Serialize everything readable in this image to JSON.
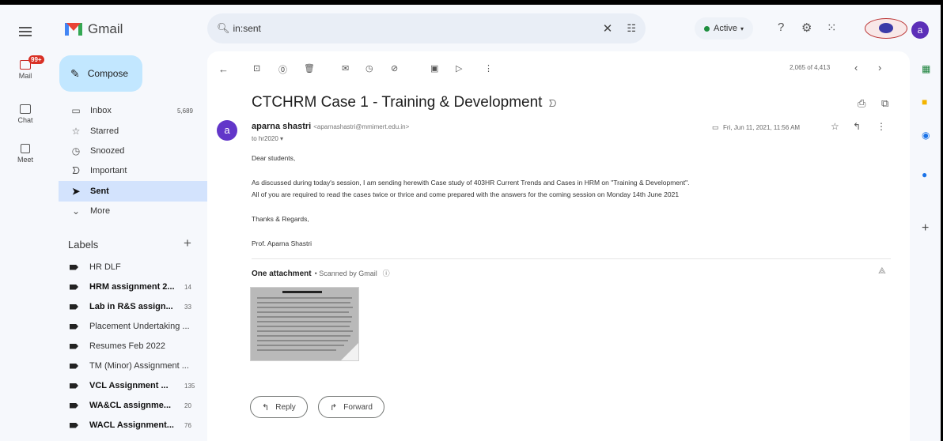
{
  "app": {
    "name": "Gmail"
  },
  "search": {
    "value": "in:sent"
  },
  "status": {
    "active_label": "Active"
  },
  "account": {
    "initial": "a"
  },
  "rail": {
    "mail_badge": "99+",
    "mail": "Mail",
    "chat": "Chat",
    "meet": "Meet"
  },
  "sidebar": {
    "compose": "Compose",
    "nav": [
      {
        "label": "Inbox",
        "count": "5,689",
        "icon": "inbox-icon"
      },
      {
        "label": "Starred",
        "count": "",
        "icon": "star-icon"
      },
      {
        "label": "Snoozed",
        "count": "",
        "icon": "clock-icon"
      },
      {
        "label": "Important",
        "count": "",
        "icon": "important-icon"
      },
      {
        "label": "Sent",
        "count": "",
        "icon": "send-icon"
      },
      {
        "label": "More",
        "count": "",
        "icon": "chevron-down-icon"
      }
    ],
    "labels_title": "Labels",
    "labels": [
      {
        "name": "HR DLF",
        "count": "",
        "bold": false
      },
      {
        "name": "HRM assignment 2...",
        "count": "14",
        "bold": true
      },
      {
        "name": "Lab in R&S assign...",
        "count": "33",
        "bold": true
      },
      {
        "name": "Placement Undertaking ...",
        "count": "",
        "bold": false
      },
      {
        "name": "Resumes Feb 2022",
        "count": "",
        "bold": false
      },
      {
        "name": "TM (Minor) Assignment ...",
        "count": "",
        "bold": false
      },
      {
        "name": "VCL Assignment ...",
        "count": "135",
        "bold": true
      },
      {
        "name": "WA&CL assignme...",
        "count": "20",
        "bold": true
      },
      {
        "name": "WACL Assignment...",
        "count": "76",
        "bold": true
      }
    ]
  },
  "toolbar": {
    "pager": "2,065 of 4,413"
  },
  "email": {
    "subject": "CTCHRM Case 1 - Training & Development",
    "sender_initial": "a",
    "sender_name": "aparna shastri",
    "sender_email": "<aparnashastri@mmimert.edu.in>",
    "to": "to hr2020",
    "date": "Fri, Jun 11, 2021, 11:56 AM",
    "body": [
      "Dear students,",
      "As discussed during today's session, I am sending herewith Case study of 403HR Current Trends and Cases in HRM on \"Training & Development\".",
      " All of you are required to read the cases twice or thrice and come prepared with the answers for the coming session on Monday 14th June 2021",
      "Thanks & Regards,",
      "Prof. Aparna Shastri"
    ],
    "attachment_title": "One attachment",
    "attachment_scan": "• Scanned by Gmail",
    "reply": "Reply",
    "forward": "Forward"
  },
  "colors": {
    "accent": "#0b57d0",
    "compose_bg": "#c2e7ff",
    "selected_bg": "#d3e3fd",
    "avatar": "#6236c9"
  }
}
